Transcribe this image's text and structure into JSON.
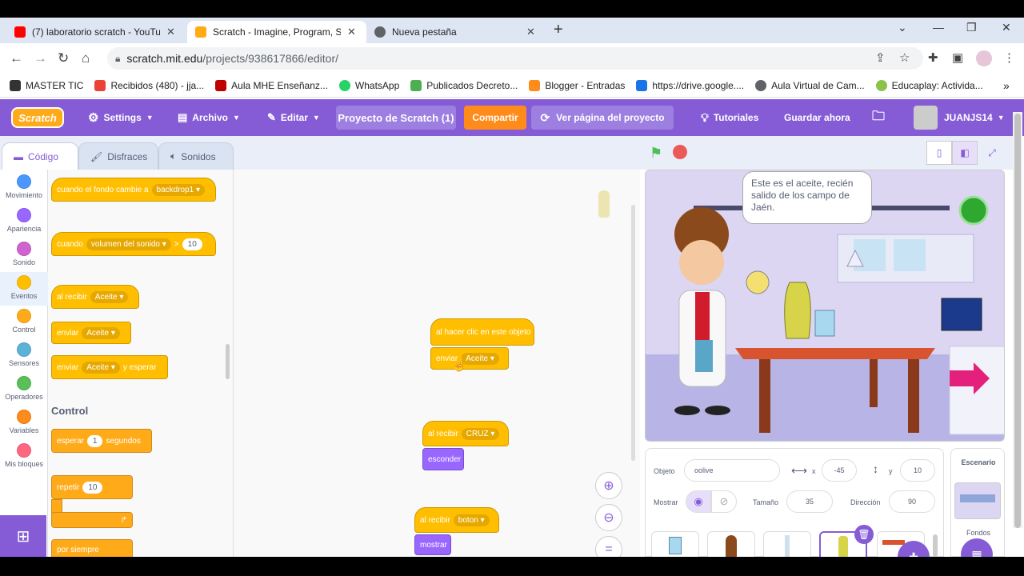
{
  "browser": {
    "tabs": [
      {
        "label": "(7) laboratorio scratch - YouTube",
        "icon_color": "#ff0000"
      },
      {
        "label": "Scratch - Imagine, Program, Share",
        "icon_color": "#ffab19"
      },
      {
        "label": "Nueva pestaña",
        "icon_color": "#5f6368"
      }
    ],
    "url_host": "scratch.mit.edu",
    "url_path": "/projects/938617866/editor/",
    "bookmarks": [
      {
        "label": "MASTER TIC",
        "color": "#333333"
      },
      {
        "label": "Recibidos (480) - jja...",
        "color": "#ea4335"
      },
      {
        "label": "Aula MHE Enseñanz...",
        "color": "#c00000"
      },
      {
        "label": "WhatsApp",
        "color": "#25d366"
      },
      {
        "label": "Publicados Decreto...",
        "color": "#4caf50"
      },
      {
        "label": "Blogger - Entradas",
        "color": "#ff8c1a"
      },
      {
        "label": "https://drive.google....",
        "color": "#1a73e8"
      },
      {
        "label": "Aula Virtual de Cam...",
        "color": "#5f6368"
      },
      {
        "label": "Educaplay: Activida...",
        "color": "#8bc34a"
      }
    ]
  },
  "menu": {
    "logo": "Scratch",
    "settings": "Settings",
    "file": "Archivo",
    "edit": "Editar",
    "project_title": "Proyecto de Scratch (1)",
    "share": "Compartir",
    "see_project": "Ver página del proyecto",
    "tutorials": "Tutoriales",
    "save_now": "Guardar ahora",
    "username": "JUANJS14"
  },
  "editor_tabs": [
    "Código",
    "Disfraces",
    "Sonidos"
  ],
  "categories": [
    {
      "label": "Movimiento",
      "color": "#4c97ff"
    },
    {
      "label": "Apariencia",
      "color": "#9966ff"
    },
    {
      "label": "Sonido",
      "color": "#cf63cf"
    },
    {
      "label": "Eventos",
      "color": "#ffbf00"
    },
    {
      "label": "Control",
      "color": "#ffab19"
    },
    {
      "label": "Sensores",
      "color": "#5cb1d6"
    },
    {
      "label": "Operadores",
      "color": "#59c059"
    },
    {
      "label": "Variables",
      "color": "#ff8c1a"
    },
    {
      "label": "Mis bloques",
      "color": "#ff6680"
    }
  ],
  "palette": {
    "b1_text": "cuando el fondo cambie a",
    "b1_drop": "backdrop1",
    "b2_text": "cuando",
    "b2_drop": "volumen del sonido",
    "b2_op": ">",
    "b2_num": "10",
    "b3_text": "al recibir",
    "b3_drop": "Aceite",
    "b4_text": "enviar",
    "b4_drop": "Aceite",
    "b5_text": "enviar",
    "b5_drop": "Aceite",
    "b5_tail": "y esperar",
    "section_control": "Control",
    "c1_text": "esperar",
    "c1_num": "1",
    "c1_tail": "segundos",
    "c2_text": "repetir",
    "c2_num": "10",
    "c3_text": "por siempre"
  },
  "scripts": {
    "s1_hat": "al hacer clic en este objeto",
    "s1_send": "enviar",
    "s1_drop": "Aceite",
    "s2_hat": "al recibir",
    "s2_drop": "CRUZ",
    "s2_action": "esconder",
    "s3_hat": "al recibir",
    "s3_drop": "boton",
    "s3_action": "mostrar"
  },
  "stage": {
    "speech": "Este es el aceite, recién salido de los campo de Jaén."
  },
  "sprite_info": {
    "sprite_label": "Objeto",
    "sprite_name": "oolive",
    "x_label": "x",
    "x_value": "-45",
    "y_label": "y",
    "y_value": "10",
    "show_label": "Mostrar",
    "size_label": "Tamaño",
    "size_value": "35",
    "direction_label": "Dirección",
    "direction_value": "90"
  },
  "stage_panel": {
    "title": "Escenario",
    "backdrops_label": "Fondos"
  },
  "colors": {
    "scratch_purple": "#855cd6",
    "events_yellow": "#ffbf00",
    "control_orange": "#ffab19",
    "share_orange": "#ff8c1a"
  }
}
